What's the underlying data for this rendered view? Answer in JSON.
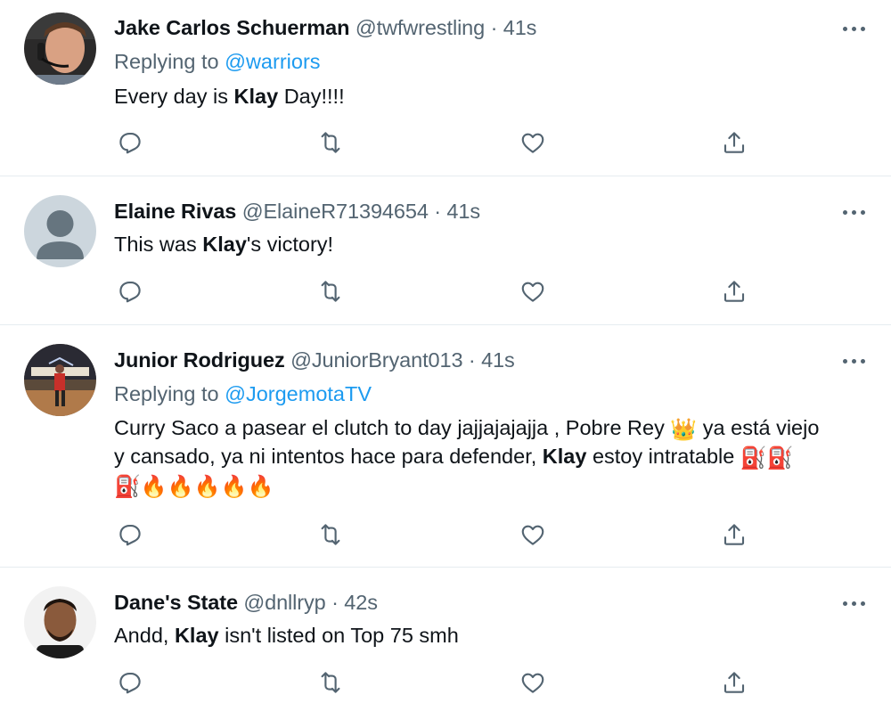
{
  "tweets": [
    {
      "name": "Jake Carlos Schuerman",
      "handle": "@twfwrestling",
      "dot": "·",
      "time": "41s",
      "replying_prefix": "Replying to",
      "replying_mention": "@warriors",
      "text_parts": [
        "Every day is ",
        "Klay",
        " Day!!!!"
      ]
    },
    {
      "name": "Elaine Rivas",
      "handle": "@ElaineR71394654",
      "dot": "·",
      "time": "41s",
      "text_parts": [
        "This was ",
        "Klay",
        "'s victory!"
      ]
    },
    {
      "name": "Junior Rodriguez",
      "handle": "@JuniorBryant013",
      "dot": "·",
      "time": "41s",
      "replying_prefix": "Replying to",
      "replying_mention": "@JorgemotaTV",
      "text_line1": "Curry Saco a pasear el clutch to day jajjajajajja , Pobre Rey ",
      "crown_emoji": "👑",
      "text_line1_end": " ya está viejo",
      "text_line2_a": "y cansado, ya ni intentos hace para defender, ",
      "text_line2_bold": "Klay",
      "text_line2_b": " estoy intratable ",
      "fuel_emoji": "⛽",
      "fire_emoji": "🔥"
    },
    {
      "name": "Dane's State",
      "handle": "@dnllryp",
      "dot": "·",
      "time": "42s",
      "text_parts": [
        "Andd, ",
        "Klay",
        " isn't listed on Top 75 smh"
      ]
    }
  ],
  "icons": {
    "reply": "reply-icon",
    "retweet": "retweet-icon",
    "like": "like-icon",
    "share": "share-icon",
    "more": "more-icon"
  },
  "colors": {
    "text": "#0f1419",
    "secondary": "#536471",
    "link": "#1d9bf0",
    "divider": "#e6ecf0"
  }
}
